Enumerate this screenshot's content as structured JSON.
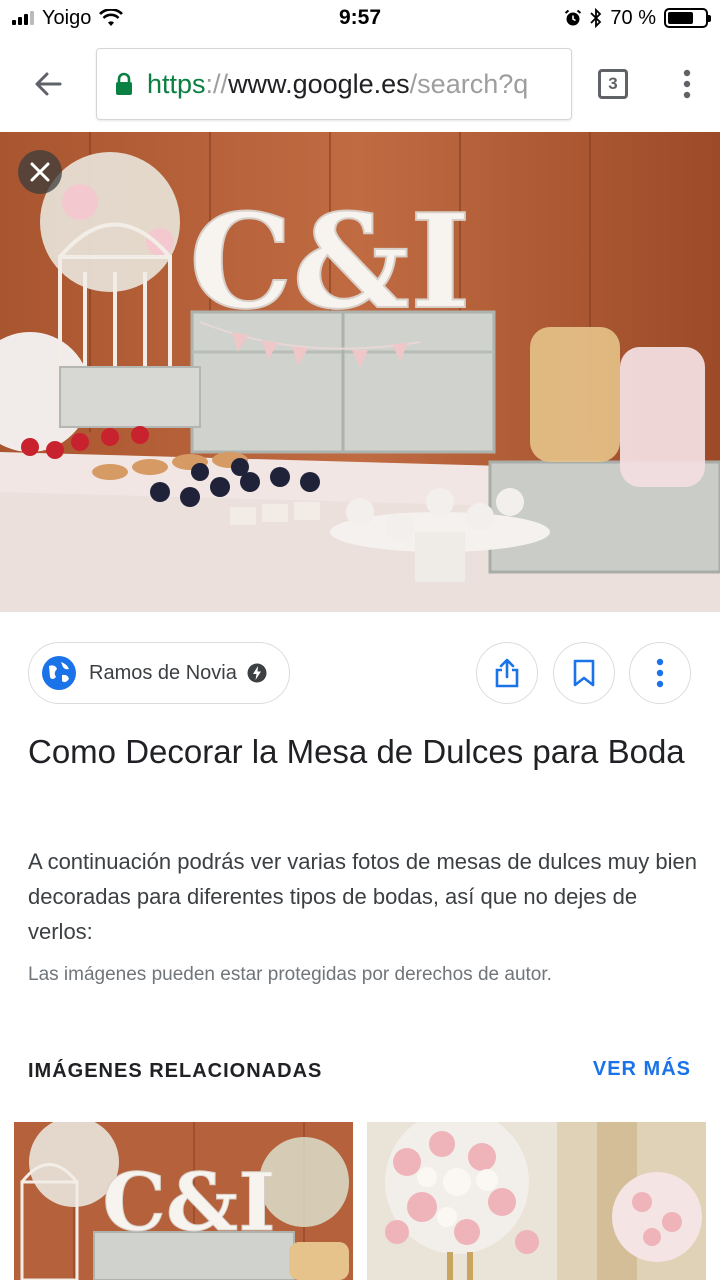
{
  "status_bar": {
    "carrier": "Yoigo",
    "time": "9:57",
    "battery_percent": "70 %",
    "battery_level": 0.7
  },
  "browser": {
    "url_scheme": "https",
    "url_sep": "://",
    "url_host": "www.google.es",
    "url_path": "/search?q",
    "tab_count": "3",
    "icons": [
      "back-arrow-icon",
      "lock-icon",
      "tabs-icon",
      "more-vert-icon"
    ]
  },
  "viewer": {
    "hero_letters": "C&I",
    "source": {
      "name": "Ramos de Novia",
      "icons": [
        "globe-icon",
        "amp-bolt-icon"
      ]
    },
    "actions": [
      "share-icon",
      "bookmark-icon",
      "more-vert-icon"
    ],
    "title": "Como Decorar la Mesa de Dulces para Boda",
    "description": "A continuación podrás ver varias fotos de mesas de dulces muy bien decoradas para diferentes tipos de bodas, así que no dejes de verlos:",
    "copyright": "Las imágenes pueden estar protegidas por derechos de autor."
  },
  "related": {
    "header": "IMÁGENES RELACIONADAS",
    "more_label": "VER MÁS",
    "thumb_letters": "C&I"
  },
  "colors": {
    "accent": "#1a73e8",
    "secure": "#0b8043",
    "wood": "#b7633d"
  }
}
